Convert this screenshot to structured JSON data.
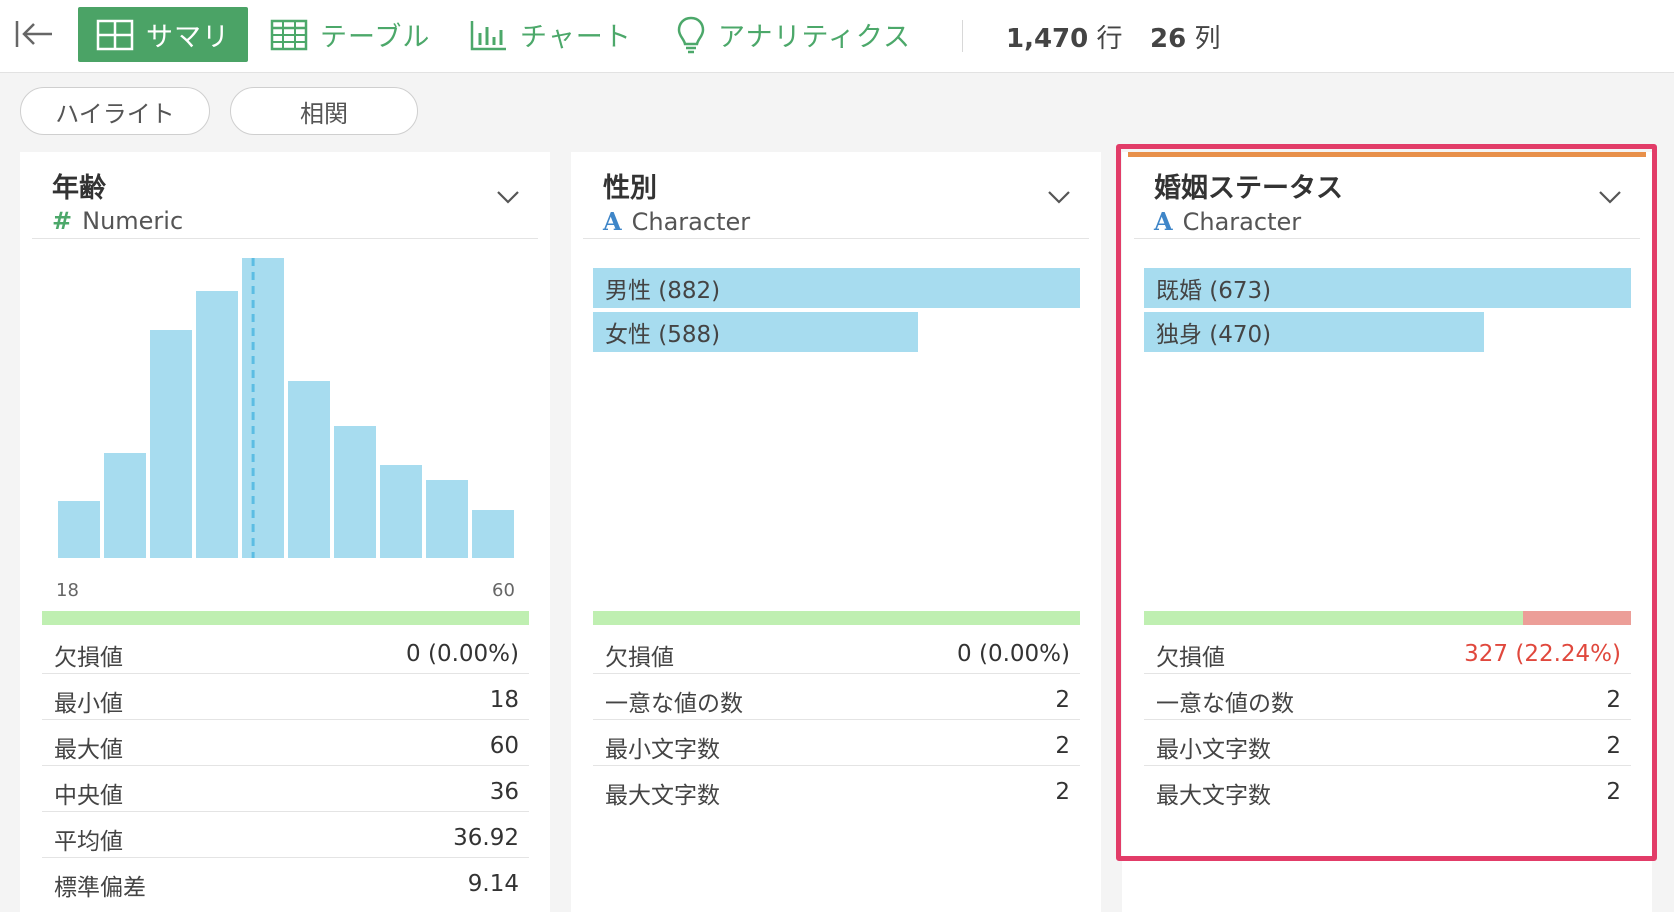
{
  "toolbar": {
    "tabs": [
      {
        "label": "サマリ",
        "icon": "grid-icon"
      },
      {
        "label": "テーブル",
        "icon": "table-icon"
      },
      {
        "label": "チャート",
        "icon": "bar-chart-icon"
      },
      {
        "label": "アナリティクス",
        "icon": "lightbulb-icon"
      }
    ],
    "rows_value": "1,470",
    "rows_unit": "行",
    "cols_value": "26",
    "cols_unit": "列"
  },
  "pills": [
    "ハイライト",
    "相関"
  ],
  "colors": {
    "accent_green": "#4ba366",
    "bar_blue": "#a7dcef",
    "quality_ok": "#bfefb1",
    "quality_missing": "#ec9e98",
    "highlight_frame": "#e23c68",
    "warn_text": "#e0483d"
  },
  "cards": [
    {
      "title": "年齢",
      "type_glyph": "#",
      "type_label": "Numeric",
      "chart_data": {
        "type": "bar",
        "bins": 10,
        "x_range": [
          18,
          60
        ],
        "x_tick_labels": [
          "18",
          "60"
        ],
        "relative_counts": [
          0.19,
          0.35,
          0.76,
          0.89,
          1.0,
          0.59,
          0.44,
          0.31,
          0.26,
          0.16
        ],
        "median_marker": 36
      },
      "quality": {
        "ok_fraction": 1.0,
        "missing_fraction": 0.0
      },
      "stats": [
        {
          "label": "欠損値",
          "value": "0 (0.00%)"
        },
        {
          "label": "最小値",
          "value": "18"
        },
        {
          "label": "最大値",
          "value": "60"
        },
        {
          "label": "中央値",
          "value": "36"
        },
        {
          "label": "平均値",
          "value": "36.92"
        },
        {
          "label": "標準偏差",
          "value": "9.14"
        }
      ]
    },
    {
      "title": "性別",
      "type_glyph": "A",
      "type_label": "Character",
      "categories": [
        {
          "label": "男性 (882)",
          "count": 882
        },
        {
          "label": "女性 (588)",
          "count": 588
        }
      ],
      "quality": {
        "ok_fraction": 1.0,
        "missing_fraction": 0.0
      },
      "stats": [
        {
          "label": "欠損値",
          "value": "0 (0.00%)"
        },
        {
          "label": "一意な値の数",
          "value": "2"
        },
        {
          "label": "最小文字数",
          "value": "2"
        },
        {
          "label": "最大文字数",
          "value": "2"
        }
      ]
    },
    {
      "title": "婚姻ステータス",
      "type_glyph": "A",
      "type_label": "Character",
      "categories": [
        {
          "label": "既婚 (673)",
          "count": 673
        },
        {
          "label": "独身 (470)",
          "count": 470
        }
      ],
      "quality": {
        "ok_fraction": 0.7776,
        "missing_fraction": 0.2224
      },
      "stats": [
        {
          "label": "欠損値",
          "value": "327 (22.24%)",
          "warn": true
        },
        {
          "label": "一意な値の数",
          "value": "2"
        },
        {
          "label": "最小文字数",
          "value": "2"
        },
        {
          "label": "最大文字数",
          "value": "2"
        }
      ]
    }
  ]
}
